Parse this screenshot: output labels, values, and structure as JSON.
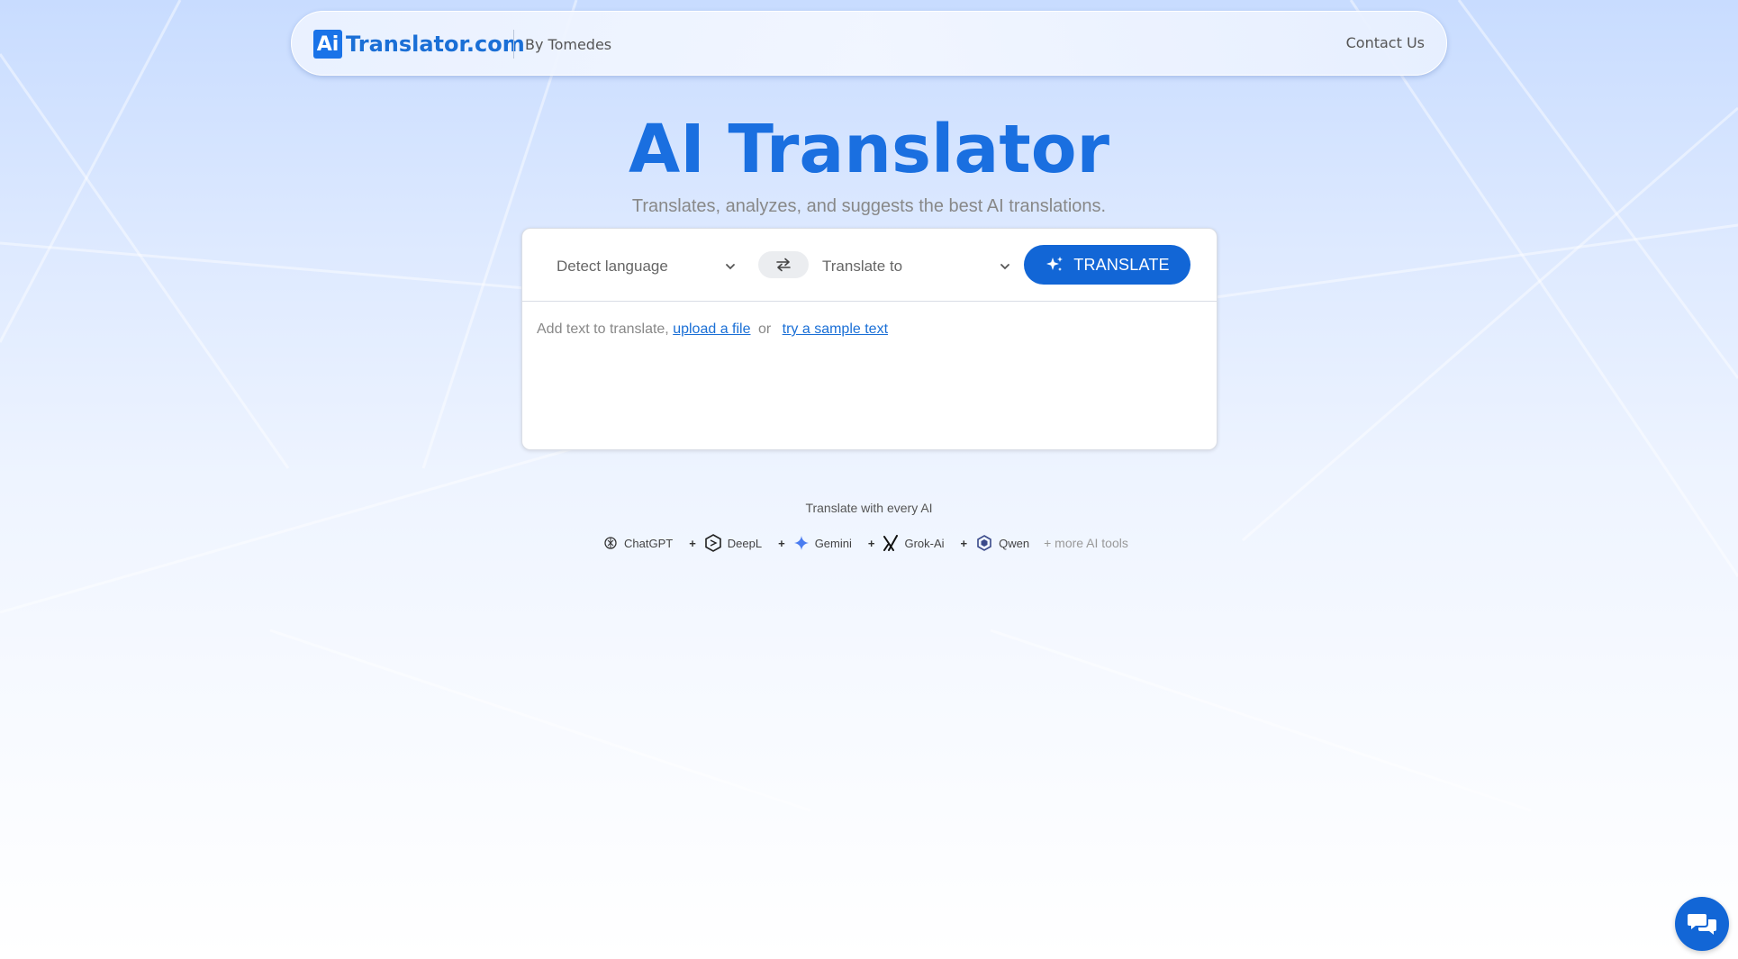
{
  "header": {
    "logo_mark": "Ai",
    "logo_text": "Translator.com",
    "by_text": "By Tomedes",
    "contact_label": "Contact Us"
  },
  "hero": {
    "title": "AI Translator",
    "subtitle": "Translates, analyzes, and suggests the best AI translations."
  },
  "translator": {
    "source_language": "Detect language",
    "target_language": "Translate to",
    "translate_label": "TRANSLATE",
    "input_prompt": "Add text to translate,",
    "upload_link": "upload a file",
    "or_text": "or",
    "sample_link": "try a sample text"
  },
  "ai_tools": {
    "caption": "Translate with every AI",
    "items": [
      {
        "name": "ChatGPT",
        "icon": "chatgpt-icon"
      },
      {
        "name": "DeepL",
        "icon": "deepl-icon"
      },
      {
        "name": "Gemini",
        "icon": "gemini-icon"
      },
      {
        "name": "Grok-Ai",
        "icon": "grok-icon"
      },
      {
        "name": "Qwen",
        "icon": "qwen-icon"
      }
    ],
    "plus": "+",
    "more_label": "+ more AI tools"
  },
  "colors": {
    "brand_blue": "#1a6fd6",
    "button_blue": "#1266d6"
  }
}
